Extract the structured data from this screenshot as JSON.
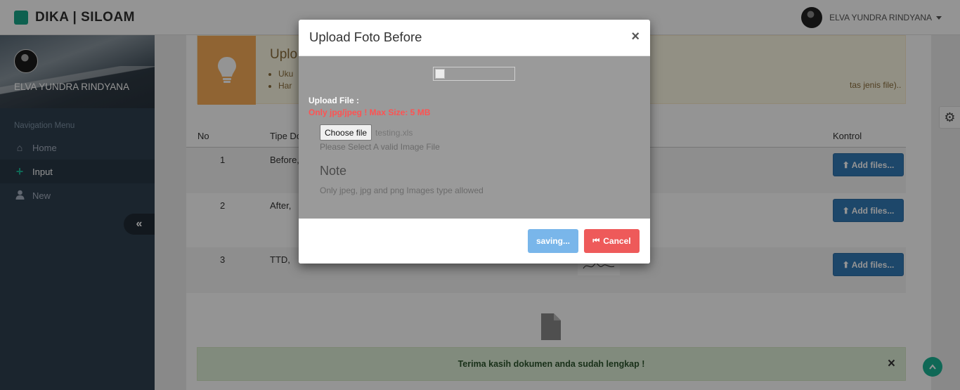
{
  "app": {
    "brand": "DIKA | SILOAM"
  },
  "user": {
    "name": "ELVA YUNDRA RINDYANA"
  },
  "sidebar": {
    "profile_name": "ELVA YUNDRA RINDYANA",
    "nav_label": "Navigation Menu",
    "items": [
      {
        "label": "Home",
        "icon": "home-icon"
      },
      {
        "label": "Input",
        "icon": "plus-icon",
        "active": true
      },
      {
        "label": "New",
        "icon": "user-icon"
      }
    ]
  },
  "tip": {
    "title": "Uplo",
    "items": [
      "Uku",
      "Har"
    ],
    "suffix": "tas jenis file).."
  },
  "table": {
    "headers": {
      "no": "No",
      "type": "Tipe Do",
      "control": "Kontrol"
    },
    "rows": [
      {
        "no": "1",
        "type": "Before,"
      },
      {
        "no": "2",
        "type": "After,"
      },
      {
        "no": "3",
        "type": "TTD,"
      }
    ],
    "add_label": "Add files..."
  },
  "alert": {
    "text": "Terima kasih dokumen anda sudah lengkap !"
  },
  "modal": {
    "title": "Upload Foto Before",
    "close": "×",
    "upload_label": "Upload File :",
    "upload_hint": "Only jpg/jpeg ! Max Size: 5 MB",
    "choose_label": "Choose file",
    "file_name": "testing.xls",
    "select_hint": "Please Select A valid Image File",
    "note_title": "Note",
    "note_text": "Only jpeg, jpg and png Images type allowed",
    "saving_label": "saving...",
    "cancel_label": "Cancel"
  },
  "colors": {
    "sidebar": "#2f4050",
    "accent": "#1ab394",
    "primary": "#337ab7",
    "danger": "#ee5a5a",
    "warning": "#f8ac59"
  }
}
